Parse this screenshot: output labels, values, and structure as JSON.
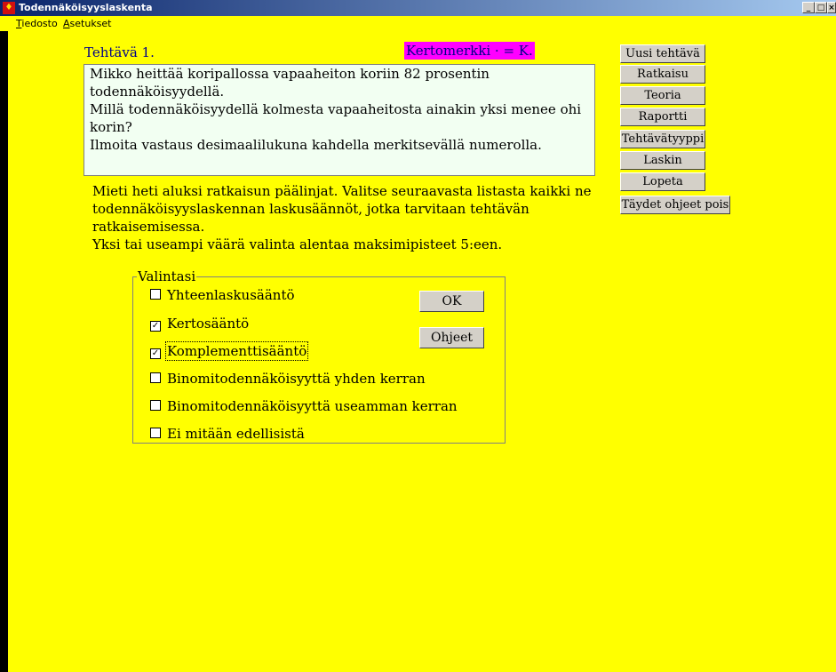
{
  "window": {
    "title": "Todennäköisyyslaskenta",
    "controls": [
      "_",
      "□",
      "×"
    ]
  },
  "menu": [
    {
      "access_key": "T",
      "rest": "iedosto"
    },
    {
      "access_key": "A",
      "rest": "setukset"
    }
  ],
  "task": {
    "title": "Tehtävä 1.",
    "hint": "Kertomerkki · =  K.",
    "problem_lines": [
      "Mikko heittää koripallossa vapaaheiton koriin 82 prosentin todennäköisyydellä.",
      "Millä todennäköisyydellä kolmesta vapaaheitosta ainakin yksi menee ohi korin?",
      "Ilmoita vastaus desimaalilukuna kahdella merkitsevällä numerolla."
    ],
    "instruction_lines": [
      "Mieti heti aluksi ratkaisun päälinjat. Valitse seuraavasta listasta kaikki ne",
      "todennäköisyyslaskennan laskusäännöt, jotka tarvitaan tehtävän ratkaisemisessa.",
      "Yksi tai useampi väärä valinta alentaa maksimipisteet 5:een."
    ]
  },
  "sidebar": {
    "buttons": [
      "Uusi tehtävä",
      "Ratkaisu",
      "Teoria",
      "Raportti",
      "Tehtävätyyppi",
      "Laskin",
      "Lopeta",
      "Täydet ohjeet pois"
    ]
  },
  "choices": {
    "label": "Valintasi",
    "options": [
      {
        "label": "Yhteenlaskusääntö",
        "checked": false
      },
      {
        "label": "Kertosääntö",
        "checked": true
      },
      {
        "label": "Komplementtisääntö",
        "checked": true
      },
      {
        "label": "Binomitodennäköisyyttä yhden kerran",
        "checked": false
      },
      {
        "label": "Binomitodennäköisyyttä useamman kerran",
        "checked": false
      },
      {
        "label": "Ei mitään edellisistä",
        "checked": false
      }
    ],
    "ok_label": "OK",
    "help_label": "Ohjeet"
  },
  "colors": {
    "background": "#ffff00",
    "hint_bg": "#ff00ff",
    "title_text": "#00008b",
    "problem_bg": "#f2fff2"
  }
}
